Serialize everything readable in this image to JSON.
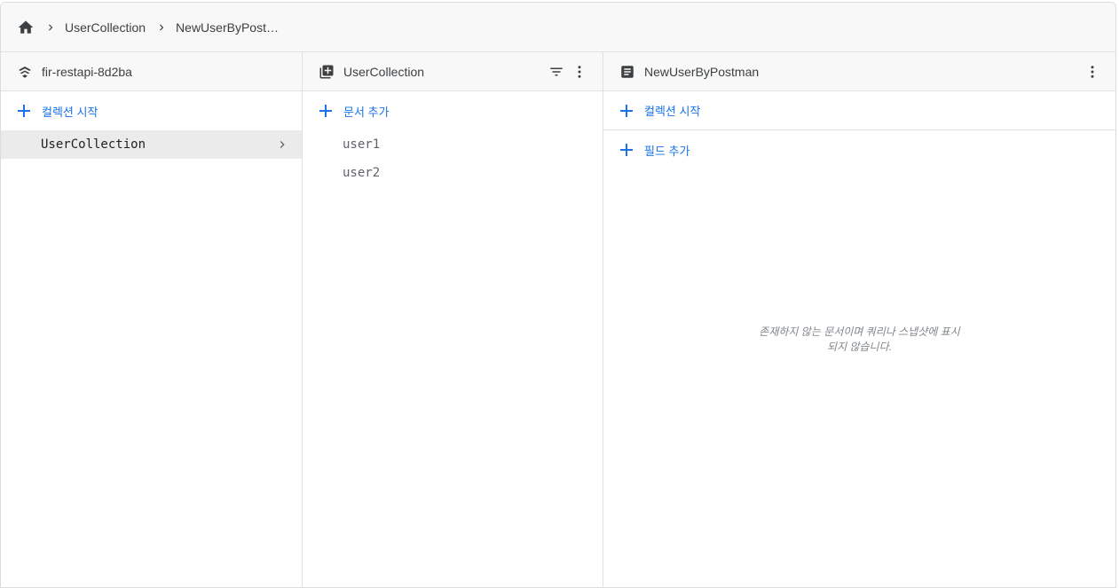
{
  "breadcrumb": {
    "items": [
      "UserCollection",
      "NewUserByPost…"
    ]
  },
  "columns": {
    "root": {
      "title": "fir-restapi-8d2ba",
      "start_collection": "컬렉션 시작",
      "items": [
        {
          "label": "UserCollection",
          "selected": true
        }
      ]
    },
    "collection": {
      "title": "UserCollection",
      "add_document": "문서 추가",
      "items": [
        {
          "label": "user1"
        },
        {
          "label": "user2"
        }
      ]
    },
    "document": {
      "title": "NewUserByPostman",
      "start_collection": "컬렉션 시작",
      "add_field": "필드 추가",
      "empty_line1": "존재하지 않는 문서이며 쿼리나 스냅샷에 표시",
      "empty_line2": "되지 않습니다."
    }
  },
  "colors": {
    "accent": "#1a73e8",
    "header_bg": "#f8f8f8",
    "selected_bg": "#ebebeb",
    "border": "#e0e0e0"
  },
  "icons": {
    "home": "home-icon",
    "separator": "chevron-right-icon",
    "database": "database-icon",
    "collection": "collection-icon",
    "document": "document-icon",
    "filter": "filter-icon",
    "more": "more-vert-icon",
    "add": "plus-icon"
  }
}
